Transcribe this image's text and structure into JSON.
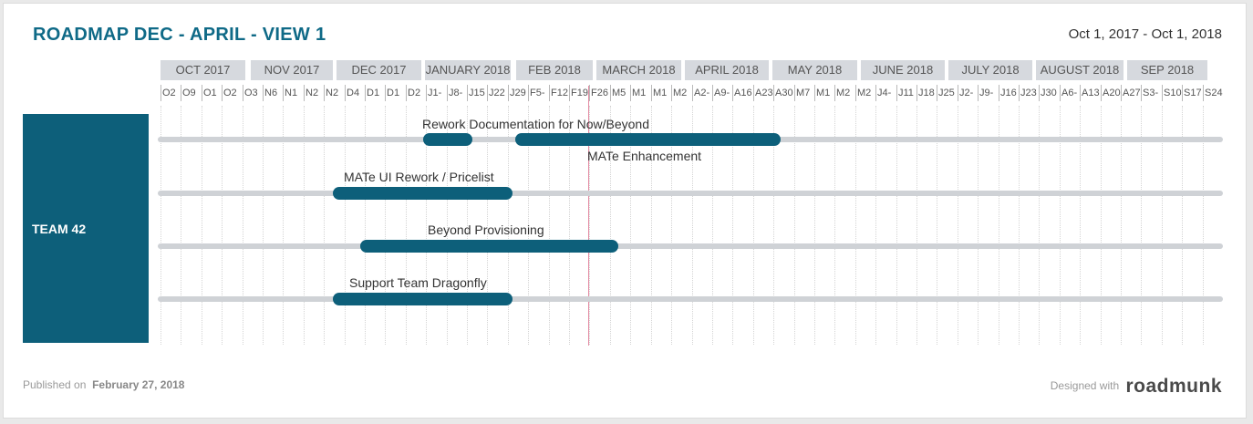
{
  "roadmap": {
    "title": "ROADMAP DEC - APRIL - VIEW 1",
    "date_range": "Oct 1, 2017 - Oct 1, 2018"
  },
  "timeline": {
    "months": [
      "OCT 2017",
      "NOV 2017",
      "DEC 2017",
      "JANUARY 2018",
      "FEB 2018",
      "MARCH 2018",
      "APRIL 2018",
      "MAY 2018",
      "JUNE 2018",
      "JULY 2018",
      "AUGUST 2018",
      "SEP 2018"
    ],
    "weeks": [
      "O2",
      "O9",
      "O1",
      "O2",
      "O3",
      "N6",
      "N1",
      "N2",
      "N2",
      "D4",
      "D1",
      "D1",
      "D2",
      "J1-",
      "J8-",
      "J15",
      "J22",
      "J29",
      "F5-",
      "F12",
      "F19",
      "F26",
      "M5",
      "M1",
      "M1",
      "M2",
      "A2-",
      "A9-",
      "A16",
      "A23",
      "A30",
      "M7",
      "M1",
      "M2",
      "M2",
      "J4-",
      "J11",
      "J18",
      "J25",
      "J2-",
      "J9-",
      "J16",
      "J23",
      "J30",
      "A6-",
      "A13",
      "A20",
      "A27",
      "S3-",
      "S10",
      "S17",
      "S24"
    ]
  },
  "team": {
    "name": "TEAM 42"
  },
  "bars": [
    {
      "label": "Rework Documentation for Now/Beyond"
    },
    {
      "label": "MATe Enhancement"
    },
    {
      "label": "MATe UI Rework / Pricelist"
    },
    {
      "label": "Beyond Provisioning"
    },
    {
      "label": "Support Team Dragonfly"
    }
  ],
  "footer": {
    "published_prefix": "Published on",
    "published_date": "February 27, 2018",
    "designed_with": "Designed with",
    "brand": "roadmunk"
  },
  "colors": {
    "accent": "#0d5f7a",
    "title": "#0f6a87",
    "track": "#cfd2d6",
    "today_line": "#e58aa2"
  }
}
